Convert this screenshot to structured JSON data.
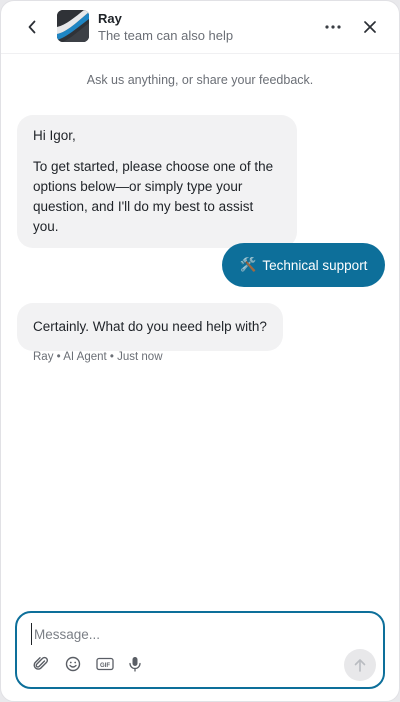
{
  "header": {
    "agent_name": "Ray",
    "subtitle": "The team can also help",
    "icons": [
      "back-icon",
      "logo",
      "more-icon",
      "close-icon"
    ]
  },
  "intro": "Ask us anything, or share your feedback.",
  "messages": [
    {
      "from": "agent",
      "paragraphs": [
        "Hi Igor,",
        "To get started, please choose one of the options below—or simply type your question, and I'll do my best to assist you."
      ]
    },
    {
      "from": "user",
      "icon": "🛠️",
      "text": "Technical support"
    },
    {
      "from": "agent",
      "text": "Certainly. What do you need help with?",
      "meta": "Ray • AI Agent • Just now"
    }
  ],
  "composer": {
    "placeholder": "Message...",
    "tools": [
      "attach-icon",
      "emoji-icon",
      "gif-icon",
      "mic-icon"
    ],
    "gif_label": "GIF"
  },
  "colors": {
    "accent": "#0d6f9a",
    "bubble_in": "#f2f2f3",
    "muted_text": "#6b6f76"
  }
}
